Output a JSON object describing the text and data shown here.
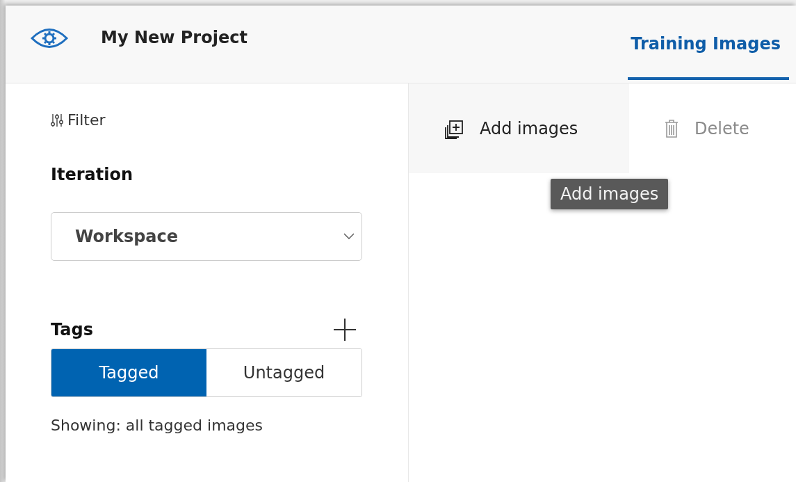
{
  "header": {
    "title": "My New Project",
    "tabs": [
      {
        "label": "Training Images",
        "selected": true
      }
    ]
  },
  "sidebar": {
    "filter": "Filter",
    "iteration": {
      "heading": "Iteration",
      "value": "Workspace"
    },
    "tags": {
      "heading": "Tags",
      "toggle": [
        {
          "label": "Tagged",
          "selected": true
        },
        {
          "label": "Untagged",
          "selected": false
        }
      ],
      "showing": "Showing: all tagged images"
    }
  },
  "toolbar": [
    {
      "kind": "add",
      "label": "Add images",
      "disabled": false,
      "hovered": true
    },
    {
      "kind": "delete",
      "label": "Delete",
      "disabled": true,
      "hovered": false
    }
  ],
  "tooltip": "Add images"
}
